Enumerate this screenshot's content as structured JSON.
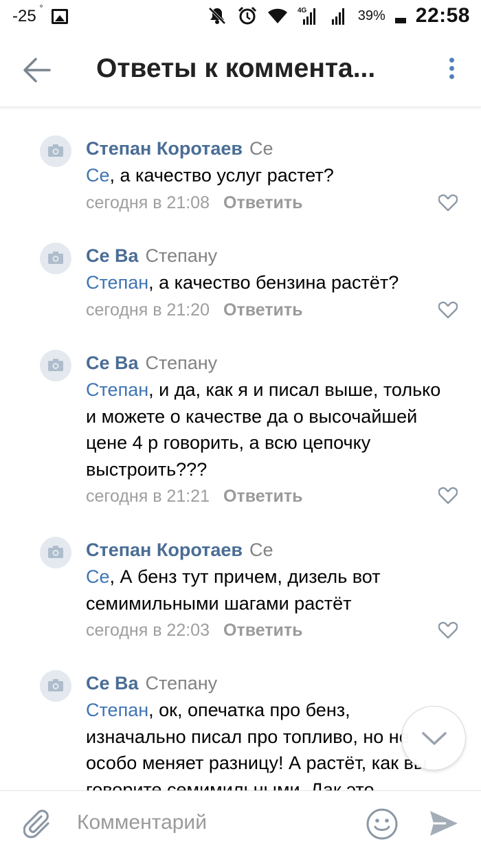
{
  "status_bar": {
    "temperature": "-25",
    "degree": "°",
    "battery": "39%",
    "time": "22:58",
    "icons": [
      "image-icon",
      "mute-icon",
      "alarm-icon",
      "wifi-icon",
      "signal-4g-icon",
      "signal-icon",
      "battery-icon"
    ]
  },
  "header": {
    "title": "Ответы к коммента...",
    "back_icon": "arrow-left-icon",
    "menu_icon": "more-vertical-icon"
  },
  "comments": [
    {
      "author": "Степан Коротаев",
      "reply_to": "Се",
      "mention": "Се",
      "text": ", а качество услуг растет?",
      "time": "сегодня в 21:08",
      "reply_label": "Ответить"
    },
    {
      "author": "Се Ва",
      "reply_to": "Степану",
      "mention": "Степан",
      "text": ", а качество бензина растёт?",
      "time": "сегодня в 21:20",
      "reply_label": "Ответить"
    },
    {
      "author": "Се Ва",
      "reply_to": "Степану",
      "mention": "Степан",
      "text": ", и да, как я и писал выше, только и можете о качестве да о высочайшей цене 4 р говорить, а всю цепочку выстроить???",
      "time": "сегодня в 21:21",
      "reply_label": "Ответить"
    },
    {
      "author": "Степан Коротаев",
      "reply_to": "Се",
      "mention": "Се",
      "text": ", А бенз тут причем, дизель вот семимильными шагами растёт",
      "time": "сегодня в 22:03",
      "reply_label": "Ответить"
    },
    {
      "author": "Се Ва",
      "reply_to": "Степану",
      "mention": "Степан",
      "text": ", ок, опечатка про бенз, изначально писал про топливо, но не особо меняет разницу! А растёт, как вы говорите семимильными. Дак это",
      "time": "",
      "reply_label": ""
    }
  ],
  "composer": {
    "placeholder": "Комментарий",
    "attach_icon": "paperclip-icon",
    "emoji_icon": "smile-icon",
    "send_icon": "send-icon"
  },
  "colors": {
    "author": "#4a6d95",
    "mention": "#3f74b3",
    "meta": "#9e9e9e",
    "accent": "#5181b8"
  }
}
